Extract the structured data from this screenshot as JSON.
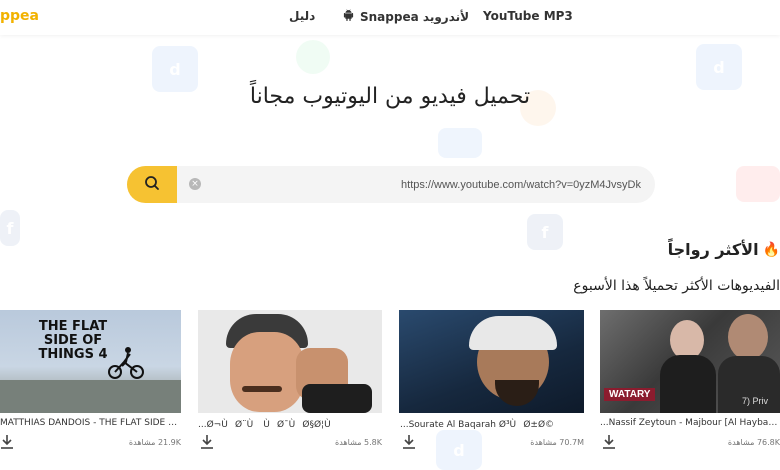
{
  "header": {
    "logo": "ppea",
    "nav": {
      "guide": "دليل",
      "android": "Snappea لأندرويد",
      "mp3": "YouTube MP3"
    }
  },
  "hero": {
    "title": "تحميل فيديو من اليوتيوب مجاناً"
  },
  "search": {
    "value": "https://www.youtube.com/watch?v=0yzM4JvsyDk"
  },
  "trending": {
    "title": "الأكثر رواجاً",
    "subtitle": "الفيديوهات الأكثر تحميلاً هذا الأسبوع"
  },
  "videos": [
    {
      "title": "...Nassif Zeytoun - Majbour [Al Hayba Serie",
      "views": "76.8K مشاهدة",
      "thumb_text": "WATARY",
      "thumb_sub": "7) Priv"
    },
    {
      "title": "...Sourate Al Baqarah Ø³ÙØ±Ø©",
      "views": "70.7M مشاهدة",
      "thumb_text": "",
      "thumb_sub": ""
    },
    {
      "title": "...Ø¬ÙØ¨Ù ÙØ¯ÙØ§Ø¦Ù",
      "views": "5.8K مشاهدة",
      "thumb_text": "",
      "thumb_sub": ""
    },
    {
      "title": "MATTHIAS DANDOIS - THE FLAT SIDE OF",
      "views": "21.9K مشاهدة",
      "thumb_text": "THE FLAT SIDE OF THINGS 4",
      "thumb_sub": ""
    }
  ],
  "colors": {
    "accent": "#f6c232",
    "logo": "#f2b200",
    "search_bg": "#f4f4f4"
  }
}
